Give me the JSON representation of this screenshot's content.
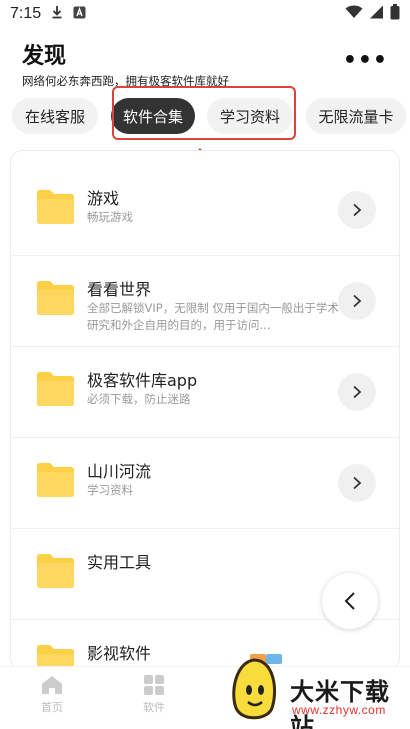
{
  "status_bar": {
    "time": "7:15"
  },
  "header": {
    "title": "发现",
    "subtitle": "网络何必东奔西跑，拥有极客软件库就好",
    "more_label": "•••"
  },
  "tabs": [
    {
      "label": "在线客服",
      "active": false
    },
    {
      "label": "软件合集",
      "active": true
    },
    {
      "label": "学习资料",
      "active": false
    },
    {
      "label": "无限流量卡",
      "active": false
    }
  ],
  "list": [
    {
      "name": "游戏",
      "desc": "畅玩游戏"
    },
    {
      "name": "看看世界",
      "desc": "全部已解锁VIP，无限制 仅用于国内一般出于学术研究和外企自用的目的，用于访问..."
    },
    {
      "name": "极客软件库app",
      "desc": "必须下载，防止迷路"
    },
    {
      "name": "山川河流",
      "desc": "学习资料"
    },
    {
      "name": "实用工具",
      "desc": ""
    },
    {
      "name": "影视软件",
      "desc": ""
    }
  ],
  "bottom_nav": [
    {
      "label": "首页"
    },
    {
      "label": "软件"
    }
  ],
  "watermark": {
    "text": "大米下载站",
    "url": "www.zzhyw.com"
  },
  "colors": {
    "accent_dark": "#333333",
    "highlight": "#d9443a",
    "folder": "#fdd147"
  }
}
